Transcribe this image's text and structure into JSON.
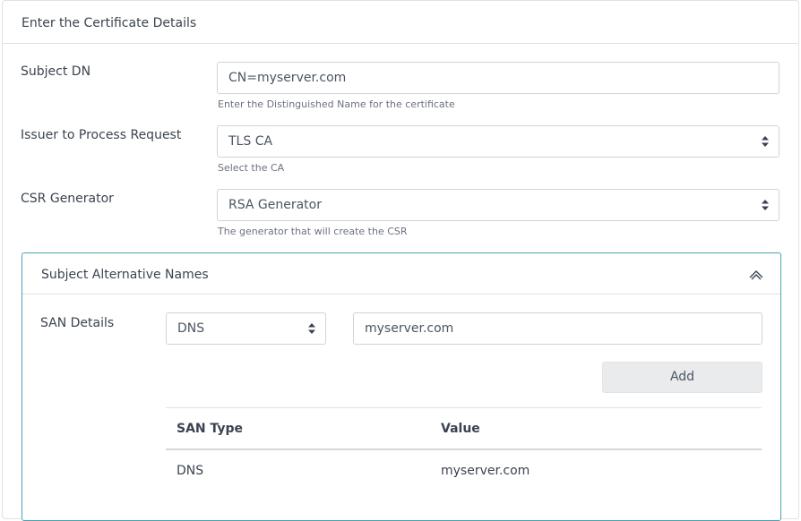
{
  "card": {
    "title": "Enter the Certificate Details"
  },
  "subject_dn": {
    "label": "Subject DN",
    "value": "CN=myserver.com",
    "help": "Enter the Distinguished Name for the certificate"
  },
  "issuer": {
    "label": "Issuer to Process Request",
    "selected": "TLS CA",
    "help": "Select the CA"
  },
  "csr_generator": {
    "label": "CSR Generator",
    "selected": "RSA Generator",
    "help": "The generator that will create the CSR"
  },
  "san": {
    "title": "Subject Alternative Names",
    "details_label": "SAN Details",
    "type_selected": "DNS",
    "value": "myserver.com",
    "add_label": "Add",
    "table": {
      "headers": [
        "SAN Type",
        "Value"
      ],
      "rows": [
        [
          "DNS",
          "myserver.com"
        ]
      ]
    }
  },
  "colors": {
    "panel_border": "#4aa3b5",
    "button_bg": "#e9ebed"
  }
}
